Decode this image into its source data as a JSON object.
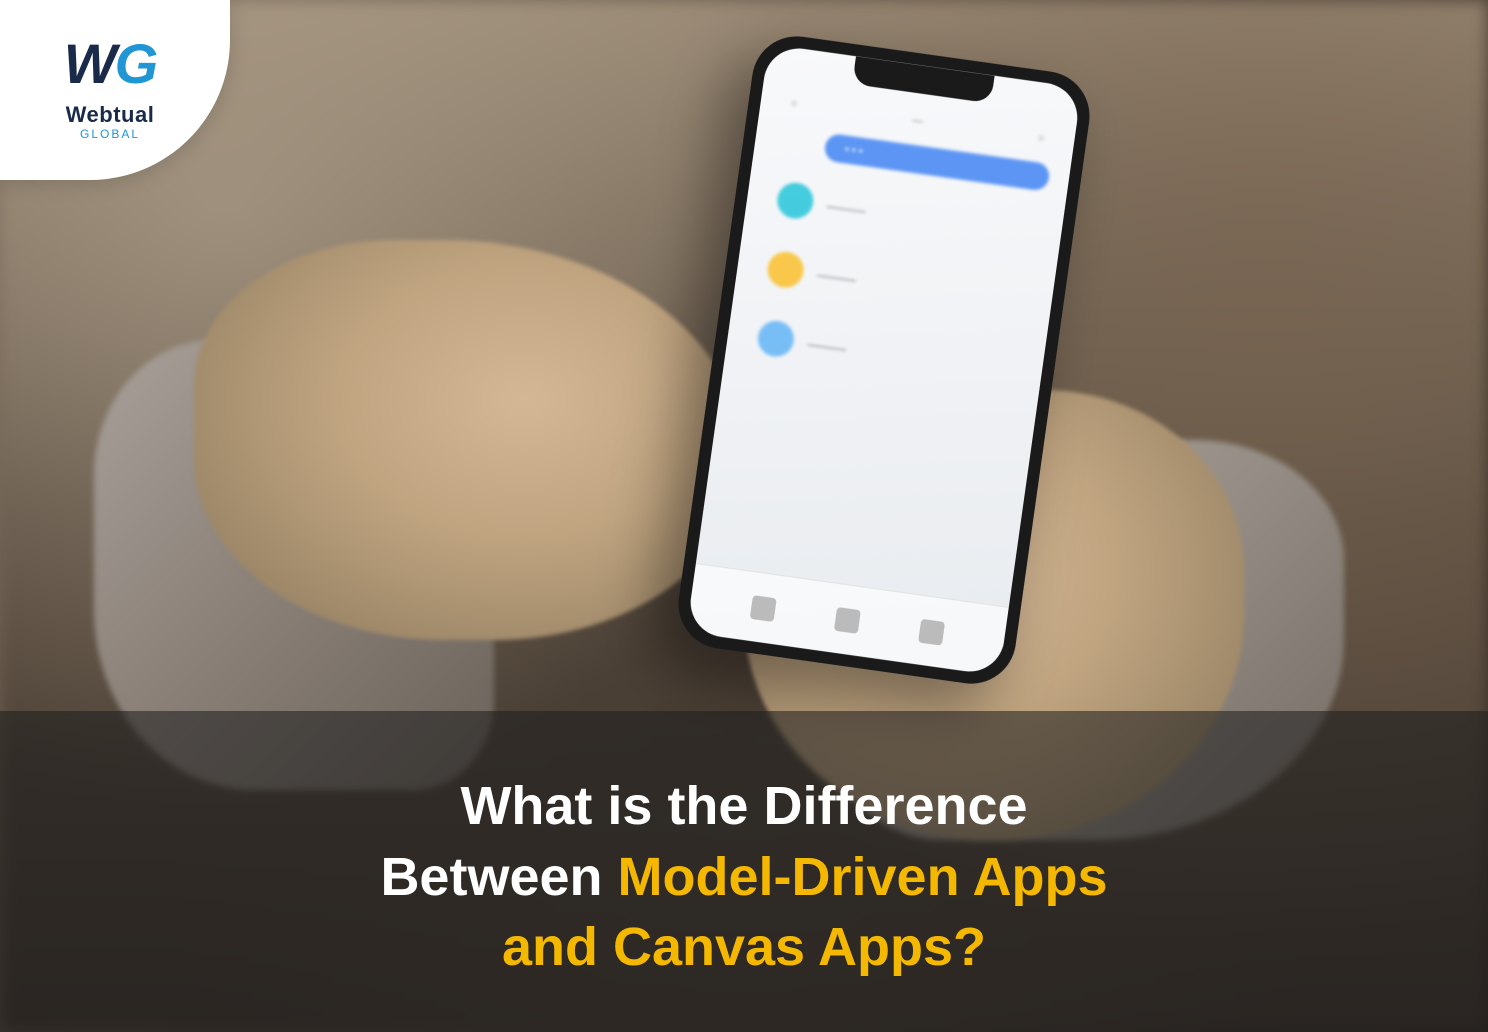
{
  "logo": {
    "mark_left": "W",
    "mark_right": "G",
    "name": "Webtual",
    "subtitle": "GLOBAL"
  },
  "title": {
    "line1": "What is the Difference",
    "line2_prefix": "Between ",
    "line2_highlight": "Model-Driven Apps",
    "line3_highlight": "and Canvas Apps?"
  },
  "colors": {
    "logo_dark": "#1a2b4a",
    "logo_blue": "#2196d4",
    "title_white": "#ffffff",
    "title_yellow": "#f5b800"
  }
}
